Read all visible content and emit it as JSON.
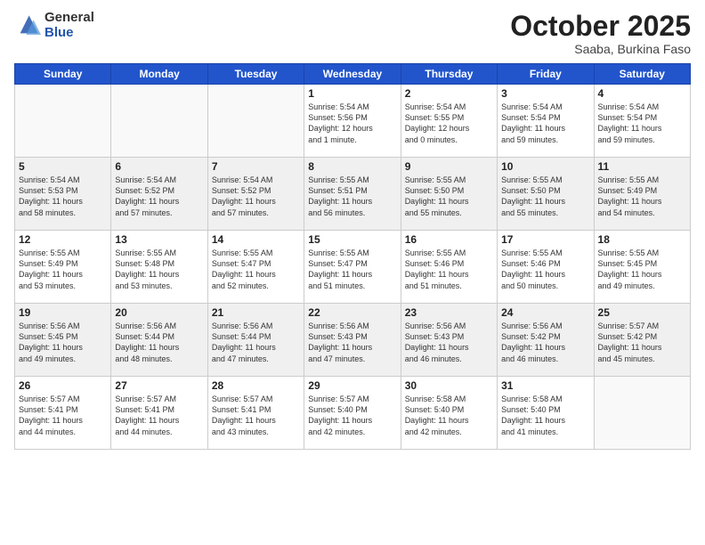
{
  "header": {
    "logo_general": "General",
    "logo_blue": "Blue",
    "month": "October 2025",
    "location": "Saaba, Burkina Faso"
  },
  "days_of_week": [
    "Sunday",
    "Monday",
    "Tuesday",
    "Wednesday",
    "Thursday",
    "Friday",
    "Saturday"
  ],
  "weeks": [
    [
      {
        "day": "",
        "text": ""
      },
      {
        "day": "",
        "text": ""
      },
      {
        "day": "",
        "text": ""
      },
      {
        "day": "1",
        "text": "Sunrise: 5:54 AM\nSunset: 5:56 PM\nDaylight: 12 hours\nand 1 minute."
      },
      {
        "day": "2",
        "text": "Sunrise: 5:54 AM\nSunset: 5:55 PM\nDaylight: 12 hours\nand 0 minutes."
      },
      {
        "day": "3",
        "text": "Sunrise: 5:54 AM\nSunset: 5:54 PM\nDaylight: 11 hours\nand 59 minutes."
      },
      {
        "day": "4",
        "text": "Sunrise: 5:54 AM\nSunset: 5:54 PM\nDaylight: 11 hours\nand 59 minutes."
      }
    ],
    [
      {
        "day": "5",
        "text": "Sunrise: 5:54 AM\nSunset: 5:53 PM\nDaylight: 11 hours\nand 58 minutes."
      },
      {
        "day": "6",
        "text": "Sunrise: 5:54 AM\nSunset: 5:52 PM\nDaylight: 11 hours\nand 57 minutes."
      },
      {
        "day": "7",
        "text": "Sunrise: 5:54 AM\nSunset: 5:52 PM\nDaylight: 11 hours\nand 57 minutes."
      },
      {
        "day": "8",
        "text": "Sunrise: 5:55 AM\nSunset: 5:51 PM\nDaylight: 11 hours\nand 56 minutes."
      },
      {
        "day": "9",
        "text": "Sunrise: 5:55 AM\nSunset: 5:50 PM\nDaylight: 11 hours\nand 55 minutes."
      },
      {
        "day": "10",
        "text": "Sunrise: 5:55 AM\nSunset: 5:50 PM\nDaylight: 11 hours\nand 55 minutes."
      },
      {
        "day": "11",
        "text": "Sunrise: 5:55 AM\nSunset: 5:49 PM\nDaylight: 11 hours\nand 54 minutes."
      }
    ],
    [
      {
        "day": "12",
        "text": "Sunrise: 5:55 AM\nSunset: 5:49 PM\nDaylight: 11 hours\nand 53 minutes."
      },
      {
        "day": "13",
        "text": "Sunrise: 5:55 AM\nSunset: 5:48 PM\nDaylight: 11 hours\nand 53 minutes."
      },
      {
        "day": "14",
        "text": "Sunrise: 5:55 AM\nSunset: 5:47 PM\nDaylight: 11 hours\nand 52 minutes."
      },
      {
        "day": "15",
        "text": "Sunrise: 5:55 AM\nSunset: 5:47 PM\nDaylight: 11 hours\nand 51 minutes."
      },
      {
        "day": "16",
        "text": "Sunrise: 5:55 AM\nSunset: 5:46 PM\nDaylight: 11 hours\nand 51 minutes."
      },
      {
        "day": "17",
        "text": "Sunrise: 5:55 AM\nSunset: 5:46 PM\nDaylight: 11 hours\nand 50 minutes."
      },
      {
        "day": "18",
        "text": "Sunrise: 5:55 AM\nSunset: 5:45 PM\nDaylight: 11 hours\nand 49 minutes."
      }
    ],
    [
      {
        "day": "19",
        "text": "Sunrise: 5:56 AM\nSunset: 5:45 PM\nDaylight: 11 hours\nand 49 minutes."
      },
      {
        "day": "20",
        "text": "Sunrise: 5:56 AM\nSunset: 5:44 PM\nDaylight: 11 hours\nand 48 minutes."
      },
      {
        "day": "21",
        "text": "Sunrise: 5:56 AM\nSunset: 5:44 PM\nDaylight: 11 hours\nand 47 minutes."
      },
      {
        "day": "22",
        "text": "Sunrise: 5:56 AM\nSunset: 5:43 PM\nDaylight: 11 hours\nand 47 minutes."
      },
      {
        "day": "23",
        "text": "Sunrise: 5:56 AM\nSunset: 5:43 PM\nDaylight: 11 hours\nand 46 minutes."
      },
      {
        "day": "24",
        "text": "Sunrise: 5:56 AM\nSunset: 5:42 PM\nDaylight: 11 hours\nand 46 minutes."
      },
      {
        "day": "25",
        "text": "Sunrise: 5:57 AM\nSunset: 5:42 PM\nDaylight: 11 hours\nand 45 minutes."
      }
    ],
    [
      {
        "day": "26",
        "text": "Sunrise: 5:57 AM\nSunset: 5:41 PM\nDaylight: 11 hours\nand 44 minutes."
      },
      {
        "day": "27",
        "text": "Sunrise: 5:57 AM\nSunset: 5:41 PM\nDaylight: 11 hours\nand 44 minutes."
      },
      {
        "day": "28",
        "text": "Sunrise: 5:57 AM\nSunset: 5:41 PM\nDaylight: 11 hours\nand 43 minutes."
      },
      {
        "day": "29",
        "text": "Sunrise: 5:57 AM\nSunset: 5:40 PM\nDaylight: 11 hours\nand 42 minutes."
      },
      {
        "day": "30",
        "text": "Sunrise: 5:58 AM\nSunset: 5:40 PM\nDaylight: 11 hours\nand 42 minutes."
      },
      {
        "day": "31",
        "text": "Sunrise: 5:58 AM\nSunset: 5:40 PM\nDaylight: 11 hours\nand 41 minutes."
      },
      {
        "day": "",
        "text": ""
      }
    ]
  ]
}
